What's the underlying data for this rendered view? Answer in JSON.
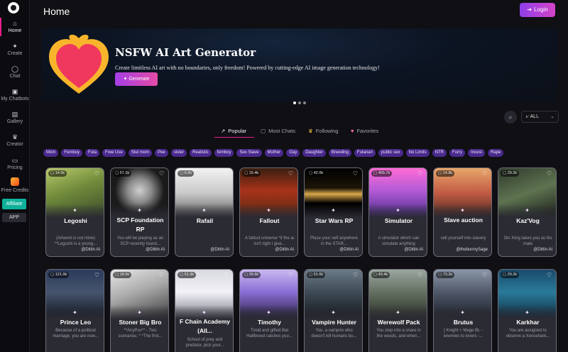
{
  "header": {
    "title": "Home",
    "login_label": "Login"
  },
  "sidebar": {
    "items": [
      {
        "label": "Home",
        "icon": "home-icon",
        "glyph": "⌂"
      },
      {
        "label": "Create",
        "icon": "sparkle-icon",
        "glyph": "✦"
      },
      {
        "label": "Chat",
        "icon": "chat-bubble-icon",
        "glyph": "◯"
      },
      {
        "label": "My Chatbots",
        "icon": "chatbot-icon",
        "glyph": "▣"
      },
      {
        "label": "Gallery",
        "icon": "gallery-icon",
        "glyph": "▤"
      },
      {
        "label": "Creator",
        "icon": "crown-icon",
        "glyph": "♛"
      },
      {
        "label": "Pricing",
        "icon": "pricing-icon",
        "glyph": "▭"
      }
    ],
    "credits_label": "Free Credits",
    "affiliate_label": "Affiliate",
    "app_label": "APP"
  },
  "banner": {
    "title": "NSFW AI Art Generator",
    "description": "Create limitless AI art with no boundaries, only freedom! Powered by cutting-edge AI image generation technology!",
    "button_label": "Generate"
  },
  "filter": {
    "selected": "ALL"
  },
  "tabs": [
    {
      "label": "Popular",
      "icon": "trend-icon",
      "glyph": "↗"
    },
    {
      "label": "Most Chats",
      "icon": "chat-bubble-icon",
      "glyph": "▢"
    },
    {
      "label": "Following",
      "icon": "crown-icon",
      "glyph": "♛"
    },
    {
      "label": "Favorites",
      "icon": "heart-icon",
      "glyph": "♥"
    }
  ],
  "tags": [
    "Mom",
    "Femboy",
    "Futa",
    "Free Use",
    "Slut mom",
    "Pee",
    "sister",
    "Realistic",
    "femboy",
    "Sex Slave",
    "Mother",
    "Gay",
    "Daughter",
    "Breeding",
    "Futanari",
    "public sex",
    "No Limits",
    "NTR",
    "Furry",
    "Incest",
    "Rape"
  ],
  "cards_row1": [
    {
      "name": "Legoshi",
      "count": "14.5k",
      "desc": "(Artwork is not mine) **Legoshi is a young...",
      "author": "@Dittin AI",
      "img": "legoshi"
    },
    {
      "name": "SCP Foundation RP",
      "count": "57.1k",
      "desc": "You will be playing as an SCP recently found...",
      "author": "@Dittin AI",
      "img": "scp"
    },
    {
      "name": "Rafail",
      "count": "6.9k",
      "desc": "",
      "author": "@Dittin AI",
      "img": "rafail"
    },
    {
      "name": "Fallout",
      "count": "15.4k",
      "desc": "A fallout universe *if the ai isn't right i give...",
      "author": "@Dittin AI",
      "img": "fallout"
    },
    {
      "name": "Star Wars RP",
      "count": "42.0k",
      "desc": "Place your self anywhere in the STAR...",
      "author": "@Dittin AI",
      "img": "starwars"
    },
    {
      "name": "Simulator",
      "count": "455.7k",
      "desc": "A simulator which can simulate anything",
      "author": "@Dittin AI",
      "img": "simulator"
    },
    {
      "name": "Slave auction",
      "count": "14.8k",
      "desc": "sell yourself into slavery",
      "author": "@thebunnySage",
      "img": "slave"
    },
    {
      "name": "Kaz'Vog",
      "count": "29.2k",
      "desc": "Orc King takes you as his mate",
      "author": "@Dittin AI",
      "img": "kazvog"
    }
  ],
  "cards_row2": [
    {
      "name": "Prince Leo",
      "count": "121.9k",
      "desc": "Because of a political marriage, you are now...",
      "img": "leo"
    },
    {
      "name": "Stoner Big Bro",
      "count": "18.5k",
      "desc": "**AnyPov** - Two scenarios: * *The first...",
      "img": "stoner"
    },
    {
      "name": "F Chain Academy (All...",
      "count": "51.9k",
      "desc": "School of prey and predator, pick your...",
      "img": "fchain"
    },
    {
      "name": "Timothy",
      "count": "26.6k",
      "desc": "Timid and gifted Bat Halfbreed catches you...",
      "img": "timothy"
    },
    {
      "name": "Vampire Hunter",
      "count": "51.6k",
      "desc": "You, a vampire who doesn't kill humans bu...",
      "img": "vampire"
    },
    {
      "name": "Werewolf Pack",
      "count": "43.4k",
      "desc": "You step into a snare in the woods, and when...",
      "img": "werewolf"
    },
    {
      "name": "Brutus",
      "count": "73.2k",
      "desc": "[ Knight + Mage BL - enemies to lovers -...",
      "img": "brutus"
    },
    {
      "name": "Karkhar",
      "count": "29.2k",
      "desc": "You are assigned to observe a Xenoshark...",
      "img": "karkhar"
    }
  ],
  "colors": {
    "accent": "#e91e8c",
    "tag_bg": "#4a2a8c",
    "affiliate": "#0fb19a",
    "login_gradient_start": "#8e3ee8",
    "login_gradient_end": "#d444c8"
  }
}
